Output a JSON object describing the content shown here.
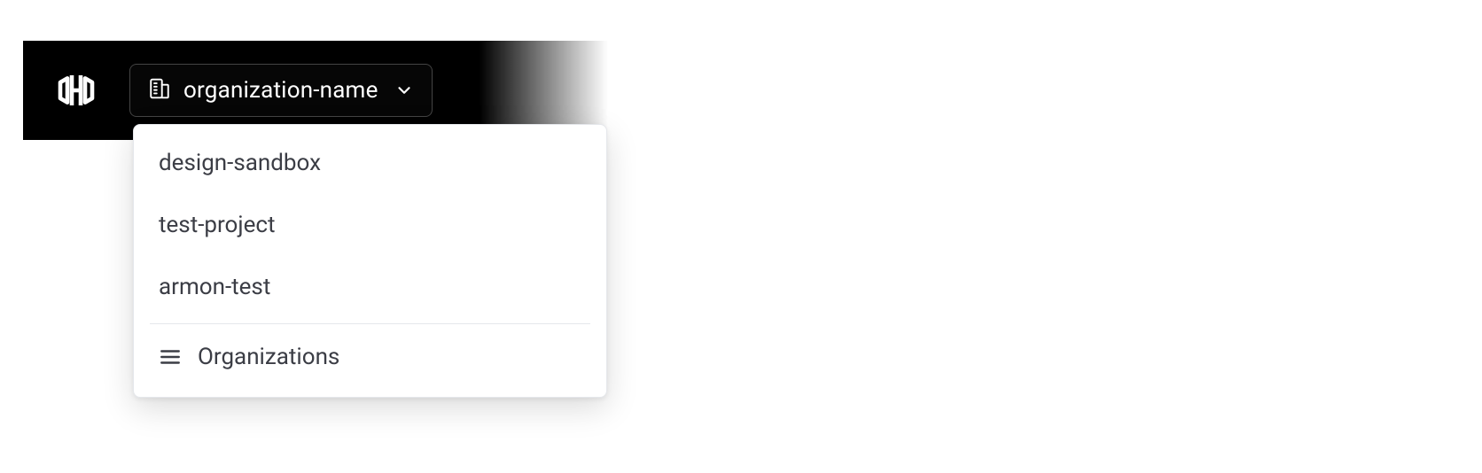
{
  "header": {
    "org_label": "organization-name"
  },
  "dropdown": {
    "items": [
      {
        "label": "design-sandbox"
      },
      {
        "label": "test-project"
      },
      {
        "label": "armon-test"
      }
    ],
    "footer_label": "Organizations"
  }
}
